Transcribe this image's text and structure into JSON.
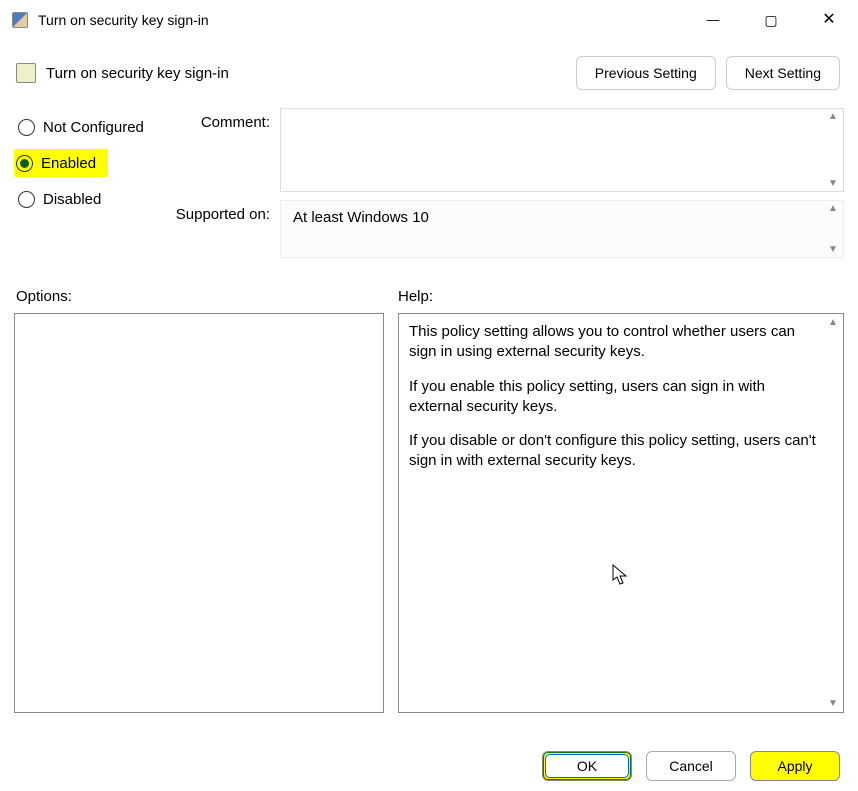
{
  "window": {
    "title": "Turn on security key sign-in",
    "heading": "Turn on security key sign-in"
  },
  "nav": {
    "prev": "Previous Setting",
    "next": "Next Setting"
  },
  "states": {
    "not_configured": "Not Configured",
    "enabled": "Enabled",
    "disabled": "Disabled",
    "selected": "enabled"
  },
  "fields": {
    "comment_label": "Comment:",
    "comment_value": "",
    "supported_label": "Supported on:",
    "supported_value": "At least Windows 10"
  },
  "sections": {
    "options_label": "Options:",
    "help_label": "Help:"
  },
  "help_text": {
    "p1": "This policy setting allows you to control whether users can sign in using external security keys.",
    "p2": "If you enable this policy setting, users can sign in with external security keys.",
    "p3": "If you disable or don't configure this policy setting, users can't sign in with external security keys."
  },
  "buttons": {
    "ok": "OK",
    "cancel": "Cancel",
    "apply": "Apply"
  },
  "highlight": {
    "color": "#ffff00",
    "targets": [
      "enabled",
      "ok",
      "apply"
    ]
  }
}
